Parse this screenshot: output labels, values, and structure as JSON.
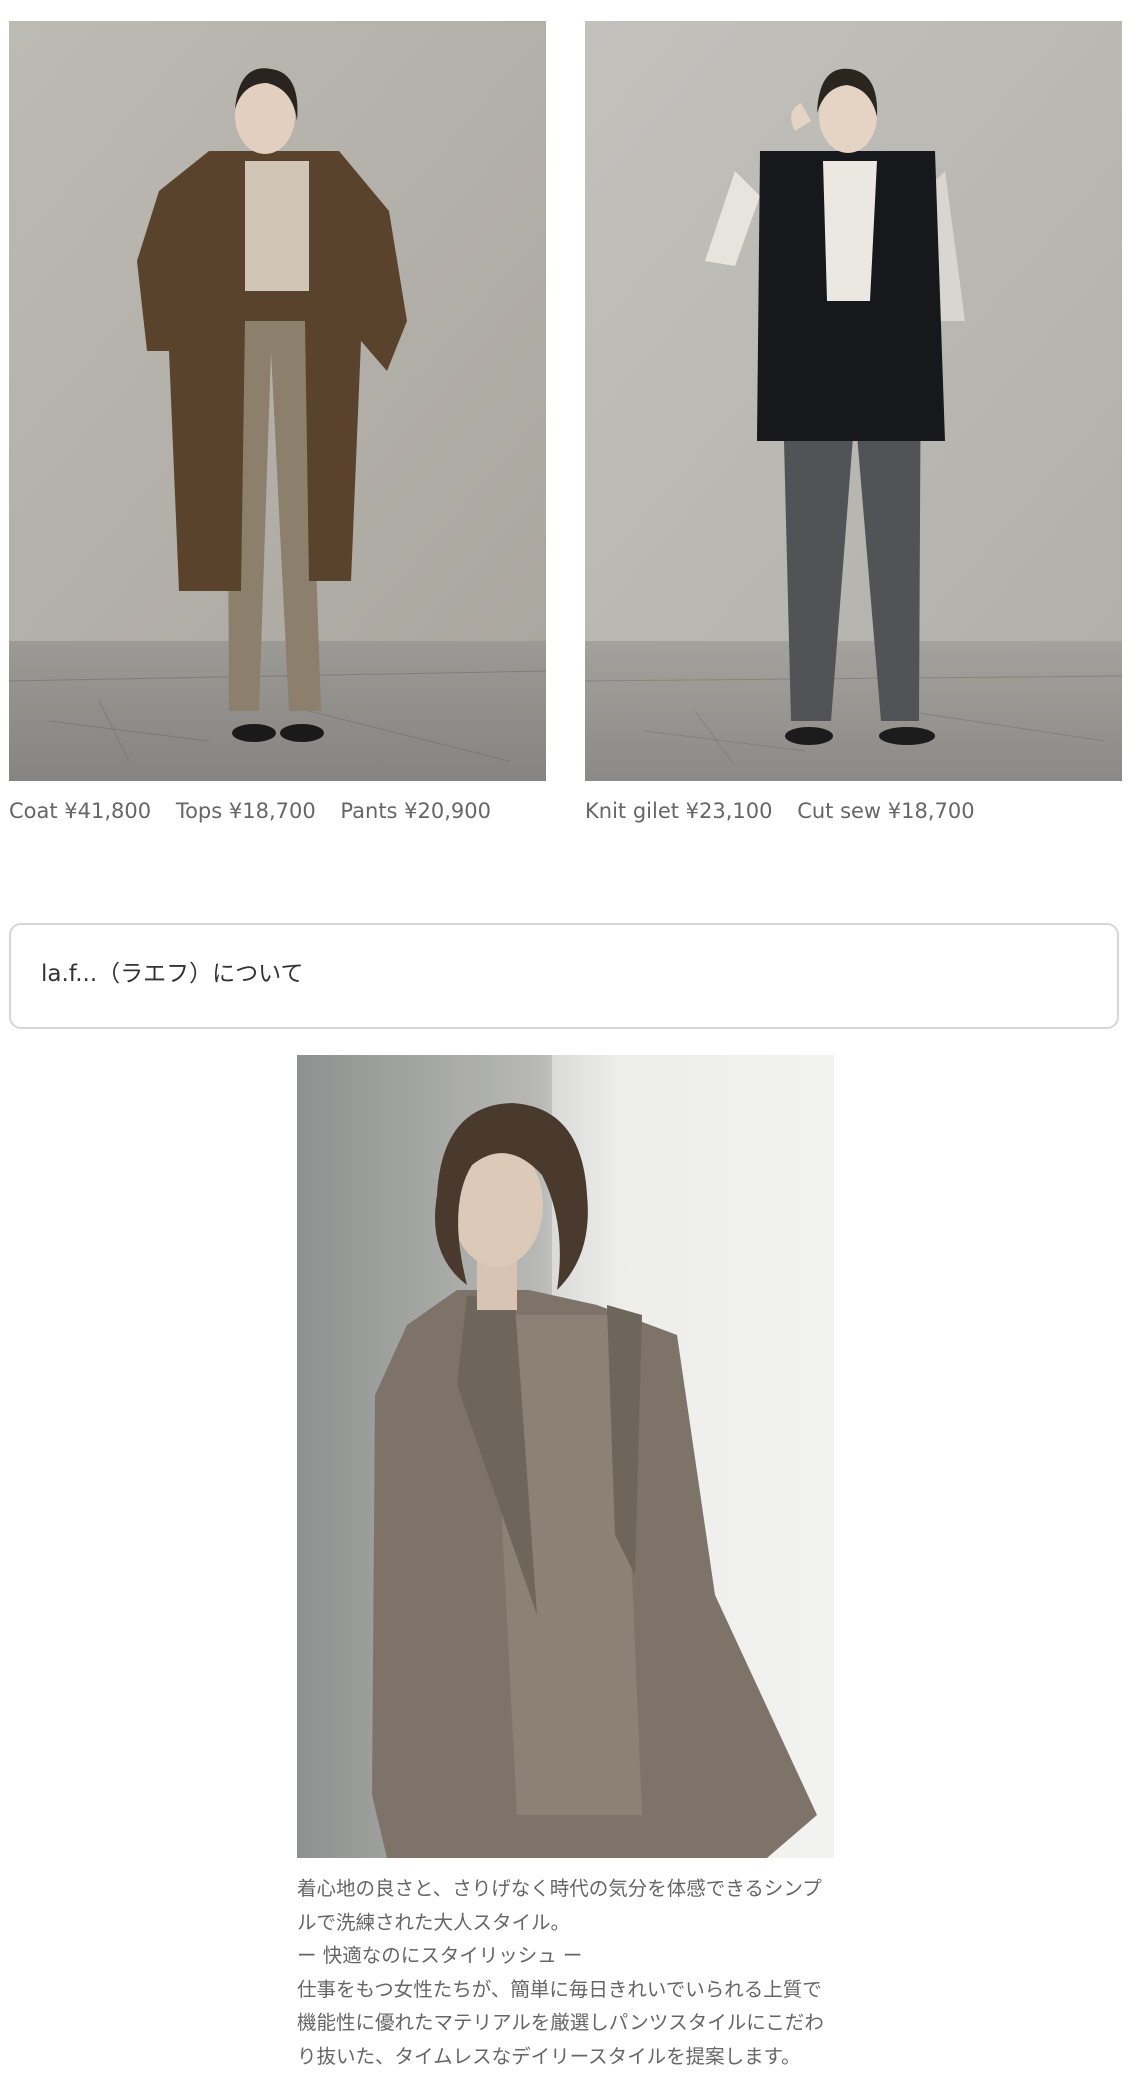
{
  "looks": [
    {
      "image_alt": "Model wearing brown long coat, beige top and taupe pants",
      "items": [
        {
          "label": "Coat ¥41,800"
        },
        {
          "label": "Tops ¥18,700"
        },
        {
          "label": "Pants ¥20,900"
        }
      ]
    },
    {
      "image_alt": "Model wearing black knit gilet, white cut sew and grey denim",
      "items": [
        {
          "label": "Knit gilet ¥23,100"
        },
        {
          "label": "Cut sew ¥18,700"
        }
      ]
    }
  ],
  "about": {
    "label": "la.f...（ラエフ）について"
  },
  "feature": {
    "image_alt": "Model in taupe jacket and top leaning against wall",
    "lines": [
      "着心地の良さと、さりげなく時代の気分を体感できるシンプ",
      "ルで洗練された大人スタイル。",
      "ー 快適なのにスタイリッシュ ー",
      "仕事をもつ女性たちが、簡単に毎日きれいでいられる上質で",
      "機能性に優れたマテリアルを厳選しパンツスタイルにこだわ",
      "り抜いた、タイムレスなデイリースタイルを提案します。"
    ]
  },
  "colors": {
    "text": "#666666",
    "border": "#d6d6d6",
    "background": "#ffffff"
  }
}
